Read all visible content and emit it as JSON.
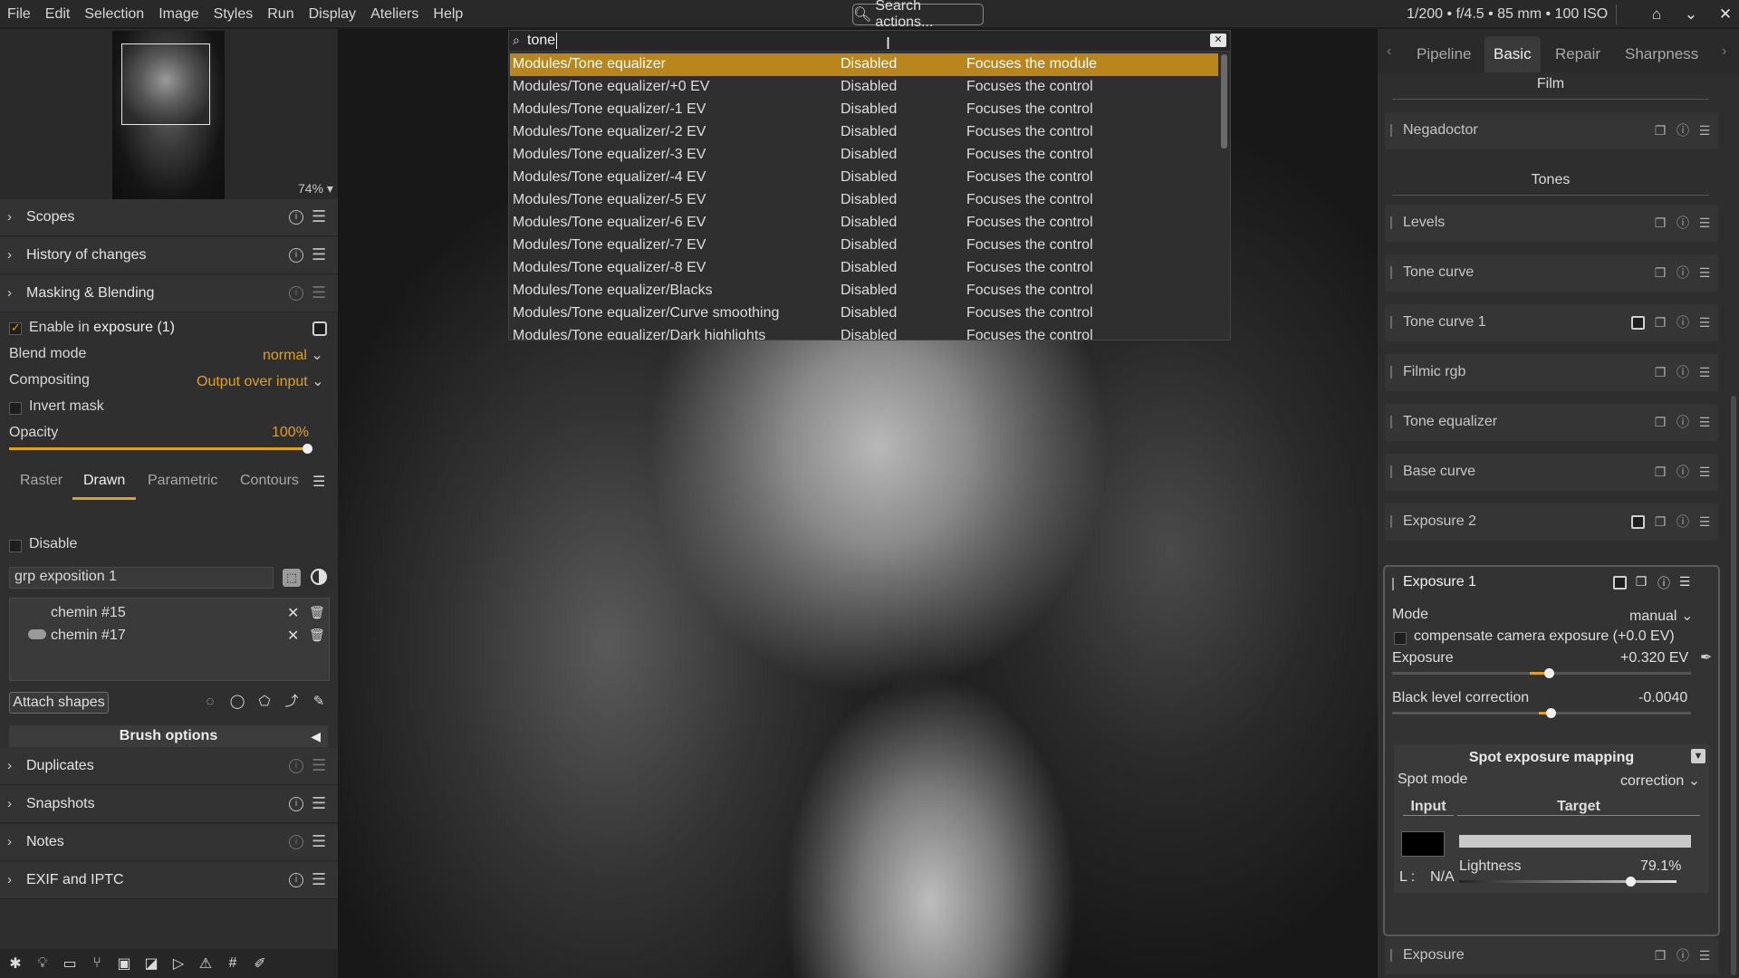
{
  "menu": [
    "File",
    "Edit",
    "Selection",
    "Image",
    "Styles",
    "Run",
    "Display",
    "Ateliers",
    "Help"
  ],
  "search_actions_label": "Search actions...",
  "exif_info": "1/200 • f/4.5 • 85 mm • 100 ISO",
  "left": {
    "zoom": "74%",
    "sections_top": [
      "Scopes",
      "History of changes",
      "Masking & Blending"
    ],
    "enable_prefix": "Enable in ",
    "enable_module": "exposure (1)",
    "blend_mode_label": "Blend mode",
    "blend_mode_value": "normal",
    "compositing_label": "Compositing",
    "compositing_value": "Output over input",
    "invert_mask": "Invert mask",
    "opacity_label": "Opacity",
    "opacity_value": "100%",
    "opacity_fraction": 1.0,
    "mask_tabs": [
      "Raster",
      "Drawn",
      "Parametric",
      "Contours"
    ],
    "disable_label": "Disable",
    "group_name": "grp exposition 1",
    "shapes": [
      "chemin #15",
      "chemin #17"
    ],
    "attach_shapes": "Attach shapes",
    "brush_options": "Brush options",
    "sections_bottom": [
      "Duplicates",
      "Snapshots",
      "Notes",
      "EXIF and IPTC"
    ]
  },
  "search": {
    "query": "tone",
    "results": [
      {
        "name": "Modules/Tone equalizer",
        "state": "Disabled",
        "action": "Focuses the module"
      },
      {
        "name": "Modules/Tone equalizer/+0 EV",
        "state": "Disabled",
        "action": "Focuses the control"
      },
      {
        "name": "Modules/Tone equalizer/-1 EV",
        "state": "Disabled",
        "action": "Focuses the control"
      },
      {
        "name": "Modules/Tone equalizer/-2 EV",
        "state": "Disabled",
        "action": "Focuses the control"
      },
      {
        "name": "Modules/Tone equalizer/-3 EV",
        "state": "Disabled",
        "action": "Focuses the control"
      },
      {
        "name": "Modules/Tone equalizer/-4 EV",
        "state": "Disabled",
        "action": "Focuses the control"
      },
      {
        "name": "Modules/Tone equalizer/-5 EV",
        "state": "Disabled",
        "action": "Focuses the control"
      },
      {
        "name": "Modules/Tone equalizer/-6 EV",
        "state": "Disabled",
        "action": "Focuses the control"
      },
      {
        "name": "Modules/Tone equalizer/-7 EV",
        "state": "Disabled",
        "action": "Focuses the control"
      },
      {
        "name": "Modules/Tone equalizer/-8 EV",
        "state": "Disabled",
        "action": "Focuses the control"
      },
      {
        "name": "Modules/Tone equalizer/Blacks",
        "state": "Disabled",
        "action": "Focuses the control"
      },
      {
        "name": "Modules/Tone equalizer/Curve smoothing",
        "state": "Disabled",
        "action": "Focuses the control"
      },
      {
        "name": "Modules/Tone equalizer/Dark highlights",
        "state": "Disabled",
        "action": "Focuses the control"
      }
    ]
  },
  "right": {
    "tabs": [
      "Pipeline",
      "Basic",
      "Repair",
      "Sharpness"
    ],
    "active_tab": "Basic",
    "group_film": "Film",
    "group_tones": "Tones",
    "film_modules": [
      "Negadoctor"
    ],
    "tone_modules": [
      "Levels",
      "Tone curve",
      "Tone curve 1",
      "Filmic rgb",
      "Tone equalizer",
      "Base curve",
      "Exposure 2"
    ],
    "exposure1": {
      "title": "Exposure 1",
      "mode_label": "Mode",
      "mode_value": "manual",
      "compensate": "compensate camera exposure (+0.0 EV)",
      "exposure_label": "Exposure",
      "exposure_value": "+0.320 EV",
      "black_label": "Black level correction",
      "black_value": "-0.0040",
      "spot_title": "Spot exposure mapping",
      "spot_mode_label": "Spot mode",
      "spot_mode_value": "correction",
      "input_label": "Input",
      "target_label": "Target",
      "lightness_label": "Lightness",
      "lightness_value": "79.1%",
      "lightness_fraction": 0.791,
      "l_label": "L :",
      "l_value": "N/A"
    },
    "bottom_module": "Exposure"
  },
  "colors": {
    "accent": "#e0a022",
    "selection": "#b8861c"
  }
}
